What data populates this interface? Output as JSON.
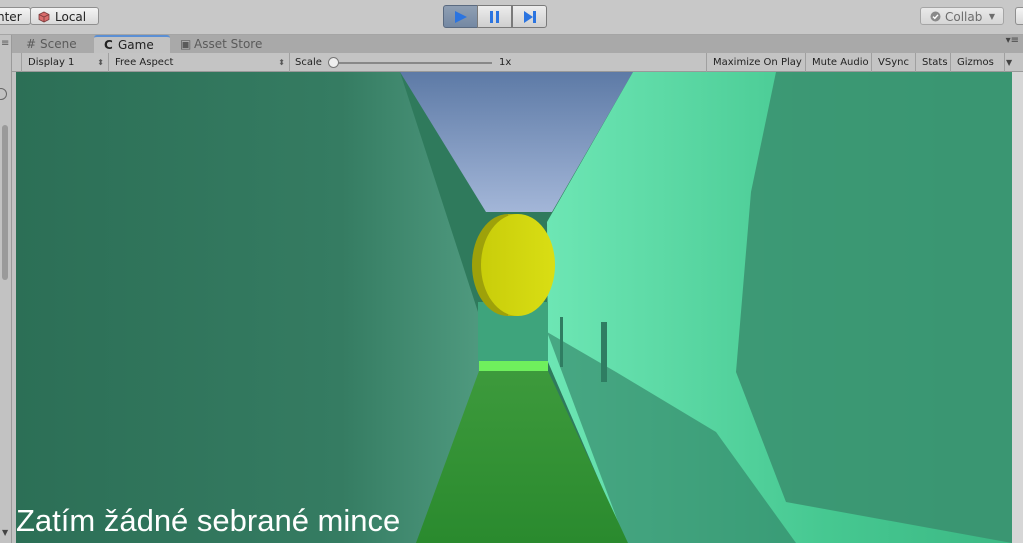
{
  "toolbar": {
    "pivot_center_label": "nter",
    "pivot_local_label": "Local",
    "play_icon": "play-icon",
    "pause_icon": "pause-icon",
    "step_icon": "step-icon",
    "collab_label": "Collab",
    "accent_color": "#7488a3"
  },
  "tabs": [
    {
      "label": "Scene",
      "icon": "hash-icon"
    },
    {
      "label": "Game",
      "icon": "pacman-icon"
    },
    {
      "label": "Asset Store",
      "icon": "bag-icon"
    }
  ],
  "game_bar": {
    "display": "Display 1",
    "aspect": "Free Aspect",
    "scale_label": "Scale",
    "scale_value": "1x",
    "maximize_on_play": "Maximize On Play",
    "mute_audio": "Mute Audio",
    "vsync": "VSync",
    "stats": "Stats",
    "gizmos": "Gizmos"
  },
  "game_view": {
    "message": "Zatím žádné sebrané mince",
    "sky_color": "#7188b4",
    "wall_color": "#3a8a6c",
    "floor_color": "#2f8f36",
    "coin_color": "#c9d40c"
  }
}
